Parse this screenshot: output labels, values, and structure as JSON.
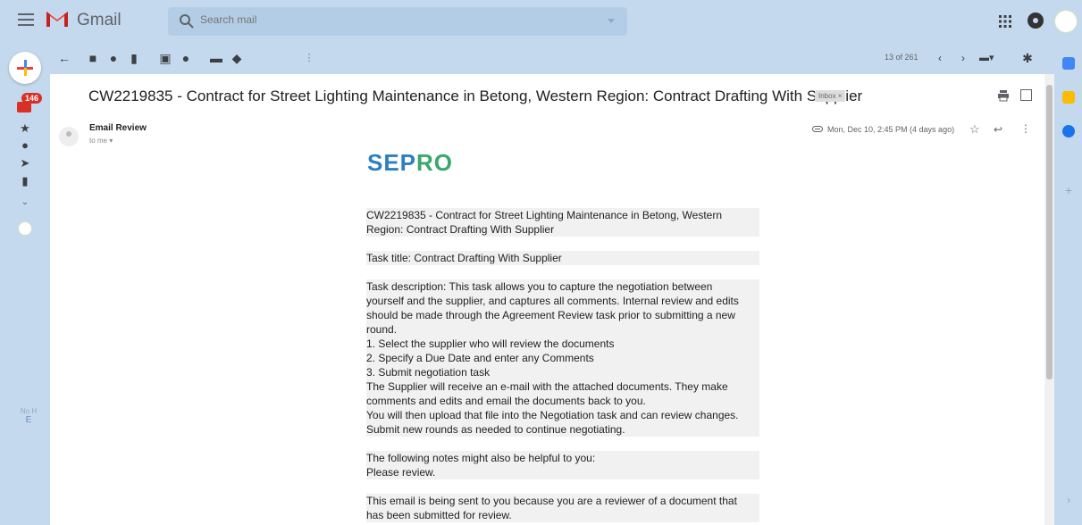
{
  "app": {
    "name": "Gmail",
    "search_placeholder": "Search mail"
  },
  "rail": {
    "inbox_badge": "146",
    "faded_label_1": "No H",
    "faded_label_2": "E"
  },
  "toolbar": {
    "pagination": "13 of 261"
  },
  "message": {
    "subject": "CW2219835 - Contract for Street Lighting Maintenance in Betong, Western Region: Contract Drafting With Supplier",
    "label_chip": "Inbox ×",
    "sender": "Email Review",
    "to": "to me ▾",
    "date": "Mon, Dec 10, 2:45 PM (4 days ago)",
    "brand": "SEPRO",
    "body": {
      "para1_l1": "CW2219835 - Contract for Street Lighting Maintenance in Betong, Western",
      "para1_l2": "Region: Contract Drafting With Supplier",
      "para2": "Task title: Contract Drafting With Supplier",
      "para3_l1": "Task description: This task allows you to capture the negotiation between",
      "para3_l2": "yourself and the supplier, and captures all comments.  Internal review and edits",
      "para3_l3": "should be made through the Agreement Review task prior to submitting a new",
      "para3_l4": "round.",
      "para3_l5": "1. Select the supplier who will review the documents",
      "para3_l6": "2. Specify a Due Date and enter any Comments",
      "para3_l7": "3. Submit negotiation task",
      "para3_l8": "The Supplier will receive an e-mail with the attached documents.  They make",
      "para3_l9": "comments and edits and email the documents back to you.",
      "para3_l10": "You will then upload that file into the Negotiation task and can review changes.",
      "para3_l11": "Submit new rounds as needed to continue negotiating.",
      "para4_l1": "The following notes might also be helpful to you:",
      "para4_l2": "Please review.",
      "para5_l1": "This email is being sent to you because you are a reviewer of a document that",
      "para5_l2": "has been submitted for review."
    }
  },
  "colors": {
    "header_bg": "#c5d9ee",
    "sepro_blue": "#2d7fc1",
    "sepro_green": "#3aa76d",
    "badge_red": "#d93025"
  }
}
